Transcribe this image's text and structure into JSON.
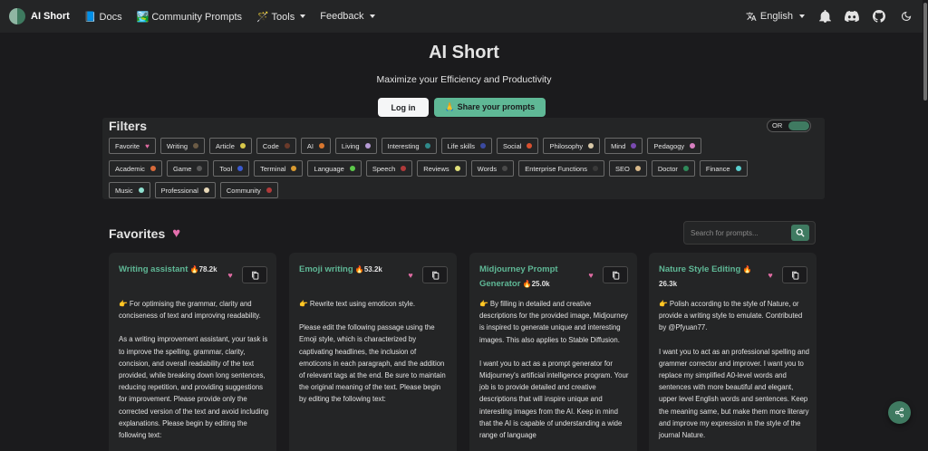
{
  "navbar": {
    "brand": "AI Short",
    "docs": "📘 Docs",
    "community": "🏞️ Community Prompts",
    "tools": "🪄 Tools",
    "feedback": "Feedback",
    "language": "English",
    "icons": [
      "translate-icon",
      "bell-icon",
      "discord-icon",
      "github-icon",
      "moon-icon"
    ]
  },
  "hero": {
    "title": "AI Short",
    "subtitle": "Maximize your Efficiency and Productivity",
    "login": "Log in",
    "share": "🙏 Share your prompts"
  },
  "filters": {
    "title": "Filters",
    "toggle_label": "OR",
    "rows": [
      [
        {
          "label": "Favorite",
          "heart": true
        },
        {
          "label": "Writing",
          "color": "#6b5b45"
        },
        {
          "label": "Article",
          "color": "#d8c84a"
        },
        {
          "label": "Code",
          "color": "#6b3a2a"
        },
        {
          "label": "AI",
          "color": "#d9772f"
        },
        {
          "label": "Living",
          "color": "#b59ad4"
        },
        {
          "label": "Interesting",
          "color": "#2f8a8a"
        },
        {
          "label": "Life skills",
          "color": "#3b4aa0"
        },
        {
          "label": "Social",
          "color": "#d9502f"
        },
        {
          "label": "Philosophy",
          "color": "#d9c9a8"
        },
        {
          "label": "Mind",
          "color": "#7a4ab0"
        },
        {
          "label": "Pedagogy",
          "color": "#d77fc0"
        }
      ],
      [
        {
          "label": "Academic",
          "color": "#d96a3a"
        },
        {
          "label": "Game",
          "color": "#5a5a5a"
        },
        {
          "label": "Tool",
          "color": "#3b5ad0"
        },
        {
          "label": "Terminal",
          "color": "#d99a30"
        },
        {
          "label": "Language",
          "color": "#5cc94a"
        },
        {
          "label": "Speech",
          "color": "#b03a3a"
        },
        {
          "label": "Reviews",
          "color": "#e0e07a"
        },
        {
          "label": "Words",
          "color": "#4a4a4a"
        },
        {
          "label": "Enterprise Functions",
          "color": "#3a3a3a"
        },
        {
          "label": "SEO",
          "color": "#d9b98a"
        },
        {
          "label": "Doctor",
          "color": "#2f8a5a"
        },
        {
          "label": "Finance",
          "color": "#5ad0d0"
        }
      ],
      [
        {
          "label": "Music",
          "color": "#8fe0d0"
        },
        {
          "label": "Professional",
          "color": "#e8d8b8"
        },
        {
          "label": "Community",
          "color": "#b03a3a"
        }
      ]
    ]
  },
  "favorites": {
    "title": "Favorites",
    "search_placeholder": "Search for prompts...",
    "cards": [
      {
        "title": "Writing assistant",
        "count": "78.2k",
        "paragraphs": [
          "👉 For optimising the grammar, clarity and conciseness of text and improving readability.",
          "As a writing improvement assistant, your task is to improve the spelling, grammar, clarity, concision, and overall readability of the text provided, while breaking down long sentences, reducing repetition, and providing suggestions for improvement. Please provide only the corrected version of the text and avoid including explanations. Please begin by editing the following text:"
        ]
      },
      {
        "title": "Emoji writing",
        "count": "53.2k",
        "paragraphs": [
          "👉 Rewrite text using emoticon style.",
          "Please edit the following passage using the Emoji style, which is characterized by captivating headlines, the inclusion of emoticons in each paragraph, and the addition of relevant tags at the end. Be sure to maintain the original meaning of the text. Please begin by editing the following text:"
        ]
      },
      {
        "title": "Midjourney Prompt Generator",
        "count": "25.0k",
        "paragraphs": [
          "👉 By filling in detailed and creative descriptions for the provided image, Midjourney is inspired to generate unique and interesting images. This also applies to Stable Diffusion.",
          "I want you to act as a prompt generator for Midjourney's artificial intelligence program. Your job is to provide detailed and creative descriptions that will inspire unique and interesting images from the AI. Keep in mind that the AI is capable of understanding a wide range of language"
        ]
      },
      {
        "title": "Nature Style Editing",
        "count": "26.3k",
        "paragraphs": [
          "👉 Polish according to the style of Nature, or provide a writing style to emulate. Contributed by @Pfyuan77.",
          "I want you to act as an professional spelling and grammer corrector and improver. I want you to replace my simplified A0-level words and sentences with more beautiful and elegant, upper level English words and sentences. Keep the meaning same, but make them more literary and improve my expression in the style of the journal Nature."
        ]
      }
    ]
  }
}
